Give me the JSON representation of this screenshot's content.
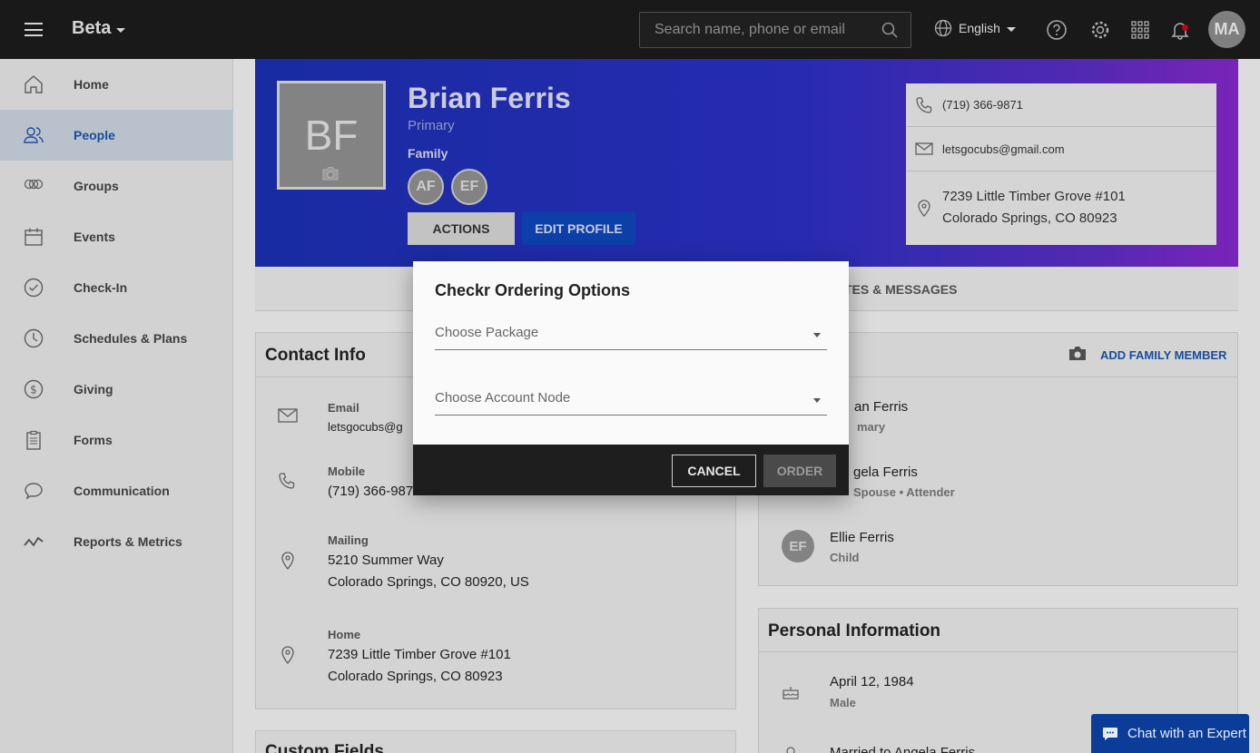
{
  "topbar": {
    "brand": "Beta",
    "search_placeholder": "Search name, phone or email",
    "language": "English",
    "avatar_initials": "MA"
  },
  "sidebar": {
    "items": [
      {
        "label": "Home",
        "icon": "home-icon"
      },
      {
        "label": "People",
        "icon": "people-icon",
        "active": true
      },
      {
        "label": "Groups",
        "icon": "groups-icon"
      },
      {
        "label": "Events",
        "icon": "calendar-icon"
      },
      {
        "label": "Check-In",
        "icon": "check-circle-icon"
      },
      {
        "label": "Schedules & Plans",
        "icon": "clock-icon"
      },
      {
        "label": "Giving",
        "icon": "dollar-icon"
      },
      {
        "label": "Forms",
        "icon": "clipboard-icon"
      },
      {
        "label": "Communication",
        "icon": "chat-bubble-icon"
      },
      {
        "label": "Reports & Metrics",
        "icon": "chart-line-icon"
      }
    ]
  },
  "profile": {
    "initials": "BF",
    "name": "Brian Ferris",
    "role": "Primary",
    "family_label": "Family",
    "family_avatars": [
      "AF",
      "EF"
    ],
    "actions_label": "ACTIONS",
    "edit_label": "EDIT PROFILE",
    "phone": "(719) 366-9871",
    "email": "letsgocubs@gmail.com",
    "address_line1": "7239 Little Timber Grove #101",
    "address_line2": "Colorado Springs, CO 80923"
  },
  "tabs": {
    "visible_partial": "TES & MESSAGES"
  },
  "contact_info": {
    "title": "Contact Info",
    "email_label": "Email",
    "email_value": "letsgocubs@g",
    "mobile_label": "Mobile",
    "mobile_value": "(719) 366-987",
    "mailing_label": "Mailing",
    "mailing_line1": "5210 Summer Way",
    "mailing_line2": "Colorado Springs, CO 80920, US",
    "home_label": "Home",
    "home_line1": "7239 Little Timber Grove #101",
    "home_line2": "Colorado Springs, CO 80923"
  },
  "custom_fields": {
    "title": "Custom Fields"
  },
  "family": {
    "add_label": "ADD FAMILY MEMBER",
    "members": [
      {
        "name": "an Ferris",
        "sub": "mary"
      },
      {
        "name": "gela Ferris",
        "sub": "Spouse • Attender"
      },
      {
        "name": "Ellie Ferris",
        "sub": "Child",
        "initials": "EF"
      }
    ]
  },
  "personal_info": {
    "title": "Personal Information",
    "birthday": "April 12, 1984",
    "gender": "Male",
    "marital_partial": "Married to Angela Ferris"
  },
  "modal": {
    "title": "Checkr Ordering Options",
    "package_placeholder": "Choose Package",
    "account_placeholder": "Choose Account Node",
    "cancel_label": "CANCEL",
    "order_label": "ORDER"
  },
  "chat": {
    "label": "Chat with an Expert"
  }
}
